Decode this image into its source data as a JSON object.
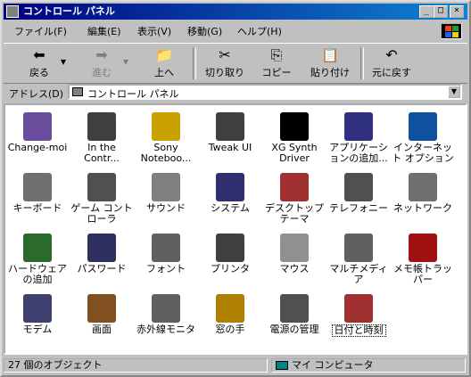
{
  "window": {
    "title": "コントロール パネル"
  },
  "menu": [
    {
      "label": "ファイル(F)"
    },
    {
      "label": "編集(E)"
    },
    {
      "label": "表示(V)"
    },
    {
      "label": "移動(G)"
    },
    {
      "label": "ヘルプ(H)"
    }
  ],
  "toolbar": {
    "back": "戻る",
    "forward": "進む",
    "up": "上へ",
    "cut": "切り取り",
    "copy": "コピー",
    "paste": "貼り付け",
    "undo": "元に戻す"
  },
  "address": {
    "label": "アドレス(D)",
    "value": "コントロール パネル"
  },
  "icons": [
    {
      "label": "Change-moi",
      "icon": "change-moi-icon",
      "color": "#6a4c9c"
    },
    {
      "label": "In the Contr...",
      "icon": "in-the-control-icon",
      "color": "#404040"
    },
    {
      "label": "Sony Noteboo...",
      "icon": "sony-notebook-icon",
      "color": "#c8a000"
    },
    {
      "label": "Tweak UI",
      "icon": "tweak-ui-icon",
      "color": "#404040"
    },
    {
      "label": "XG Synth Driver",
      "icon": "xg-synth-icon",
      "color": "#000000"
    },
    {
      "label": "アプリケーションの追加...",
      "icon": "add-remove-programs-icon",
      "color": "#303080"
    },
    {
      "label": "インターネット オプション",
      "icon": "internet-options-icon",
      "color": "#1050a0"
    },
    {
      "label": "キーボード",
      "icon": "keyboard-icon",
      "color": "#707070"
    },
    {
      "label": "ゲーム コントローラ",
      "icon": "game-controller-icon",
      "color": "#505050"
    },
    {
      "label": "サウンド",
      "icon": "sound-icon",
      "color": "#808080"
    },
    {
      "label": "システム",
      "icon": "system-icon",
      "color": "#303070"
    },
    {
      "label": "デスクトップ テーマ",
      "icon": "desktop-themes-icon",
      "color": "#a03030"
    },
    {
      "label": "テレフォニー",
      "icon": "telephony-icon",
      "color": "#505050"
    },
    {
      "label": "ネットワーク",
      "icon": "network-icon",
      "color": "#707070"
    },
    {
      "label": "ハードウェアの追加",
      "icon": "add-hardware-icon",
      "color": "#2a6a2a"
    },
    {
      "label": "パスワード",
      "icon": "password-icon",
      "color": "#303060"
    },
    {
      "label": "フォント",
      "icon": "fonts-icon",
      "color": "#606060"
    },
    {
      "label": "プリンタ",
      "icon": "printers-icon",
      "color": "#404040"
    },
    {
      "label": "マウス",
      "icon": "mouse-icon",
      "color": "#909090"
    },
    {
      "label": "マルチメディア",
      "icon": "multimedia-icon",
      "color": "#606060"
    },
    {
      "label": "メモ帳トラッパー",
      "icon": "notepad-trapper-icon",
      "color": "#a01010"
    },
    {
      "label": "モデム",
      "icon": "modem-icon",
      "color": "#404070"
    },
    {
      "label": "画面",
      "icon": "display-icon",
      "color": "#805020"
    },
    {
      "label": "赤外線モニタ",
      "icon": "infrared-monitor-icon",
      "color": "#606060"
    },
    {
      "label": "窓の手",
      "icon": "madonote-icon",
      "color": "#b08000"
    },
    {
      "label": "電源の管理",
      "icon": "power-management-icon",
      "color": "#505050"
    },
    {
      "label": "日付と時刻",
      "icon": "date-time-icon",
      "color": "#a03030"
    }
  ],
  "status": {
    "objects": "27 個のオブジェクト",
    "location": "マイ コンピュータ"
  }
}
